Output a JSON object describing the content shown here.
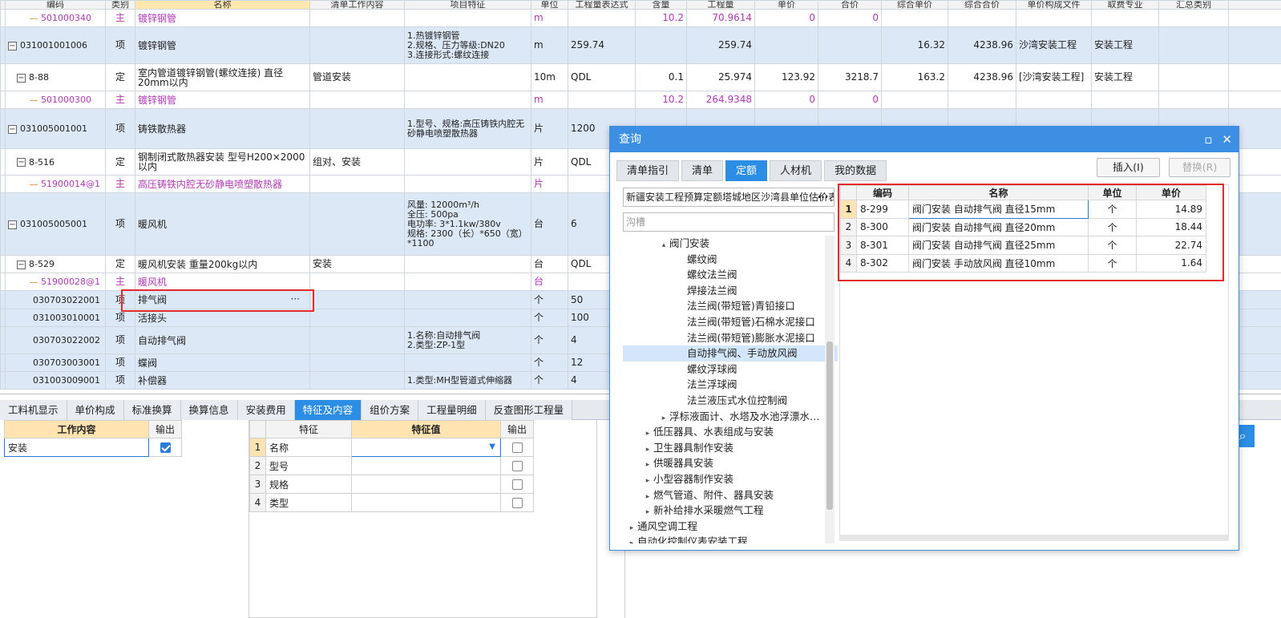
{
  "grid": {
    "headers": [
      "编码",
      "类别",
      "名称",
      "清单工作内容",
      "项目特征",
      "单位",
      "工程量表达式",
      "含量",
      "工程量",
      "单价",
      "合价",
      "综合单价",
      "综合合价",
      "单价构成文件",
      "取费专业",
      "汇总类别"
    ],
    "rows": [
      {
        "kind": "mat",
        "code": "501000340",
        "type": "主",
        "name": "镀锌钢管",
        "work": "",
        "feat": "",
        "unit": "m",
        "expr": "",
        "content": "10.2",
        "qty": "70.9614",
        "price": "0",
        "total": "0",
        "uprice": "",
        "utotal": "",
        "file": "",
        "fee": ""
      },
      {
        "kind": "item",
        "code": "031001001006",
        "type": "项",
        "name": "镀锌钢管",
        "work": "",
        "feat": "1.热镀锌钢管\n2.规格、压力等级:DN20\n3.连接形式:螺纹连接",
        "unit": "m",
        "expr": "259.74",
        "content": "",
        "qty": "259.74",
        "price": "",
        "total": "",
        "uprice": "16.32",
        "utotal": "4238.96",
        "file": "沙湾安装工程",
        "fee": "安装工程"
      },
      {
        "kind": "quota",
        "code": "8-88",
        "type": "定",
        "name": "室内管道镀锌钢管(螺纹连接) 直径20mm以内",
        "work": "管道安装",
        "feat": "",
        "unit": "10m",
        "expr": "QDL",
        "content": "0.1",
        "qty": "25.974",
        "price": "123.92",
        "total": "3218.7",
        "uprice": "163.2",
        "utotal": "4238.96",
        "file": "[沙湾安装工程]",
        "fee": "安装工程"
      },
      {
        "kind": "mat",
        "code": "501000300",
        "type": "主",
        "name": "镀锌钢管",
        "work": "",
        "feat": "",
        "unit": "m",
        "expr": "",
        "content": "10.2",
        "qty": "264.9348",
        "price": "0",
        "total": "0",
        "uprice": "",
        "utotal": "",
        "file": "",
        "fee": ""
      },
      {
        "kind": "item",
        "code": "031005001001",
        "type": "项",
        "name": "铸铁散热器",
        "work": "",
        "feat": "1.型号、规格:高压铸铁内腔无砂静电喷塑散热器",
        "unit": "片",
        "expr": "1200",
        "content": "",
        "qty": "",
        "price": "",
        "total": "",
        "uprice": "",
        "utotal": "",
        "file": "",
        "fee": ""
      },
      {
        "kind": "quota",
        "code": "8-516",
        "type": "定",
        "name": "钢制闭式散热器安装 型号H200×2000以内",
        "work": "组对、安装",
        "feat": "",
        "unit": "片",
        "expr": "QDL",
        "content": "",
        "qty": "",
        "price": "",
        "total": "",
        "uprice": "",
        "utotal": "",
        "file": "",
        "fee": ""
      },
      {
        "kind": "mat",
        "code": "51900014@1",
        "type": "主",
        "name": "高压铸铁内腔无砂静电喷塑散热器",
        "work": "",
        "feat": "",
        "unit": "片",
        "expr": "",
        "content": "",
        "qty": "",
        "price": "",
        "total": "",
        "uprice": "",
        "utotal": "",
        "file": "",
        "fee": ""
      },
      {
        "kind": "item",
        "code": "031005005001",
        "type": "项",
        "name": "暖风机",
        "work": "",
        "feat": "风量: 12000m³/h\n全压: 500pa\n电功率: 3*1.1kw/380v\n规格: 2300（长）*650（宽）*1100",
        "unit": "台",
        "expr": "6",
        "content": "",
        "qty": "",
        "price": "",
        "total": "",
        "uprice": "",
        "utotal": "",
        "file": "",
        "fee": ""
      },
      {
        "kind": "quota",
        "code": "8-529",
        "type": "定",
        "name": "暖风机安装 重量200kg以内",
        "work": "安装",
        "feat": "",
        "unit": "台",
        "expr": "QDL",
        "content": "",
        "qty": "",
        "price": "",
        "total": "",
        "uprice": "",
        "utotal": "",
        "file": "",
        "fee": ""
      },
      {
        "kind": "mat",
        "code": "51900028@1",
        "type": "主",
        "name": "暖风机",
        "work": "",
        "feat": "",
        "unit": "台",
        "expr": "",
        "content": "",
        "qty": "",
        "price": "",
        "total": "",
        "uprice": "",
        "utotal": "",
        "file": "",
        "fee": ""
      },
      {
        "kind": "item",
        "code": "030703022001",
        "type": "项",
        "name": "排气阀",
        "work": "",
        "feat": "",
        "unit": "个",
        "expr": "50",
        "content": "",
        "qty": "",
        "price": "",
        "total": "",
        "uprice": "",
        "utotal": "",
        "file": "",
        "fee": "",
        "more": "···"
      },
      {
        "kind": "item",
        "code": "031003010001",
        "type": "项",
        "name": "活接头",
        "work": "",
        "feat": "",
        "unit": "个",
        "expr": "100",
        "content": "",
        "qty": "",
        "price": "",
        "total": "",
        "uprice": "",
        "utotal": "",
        "file": "",
        "fee": ""
      },
      {
        "kind": "item",
        "code": "030703022002",
        "type": "项",
        "name": "自动排气阀",
        "work": "",
        "feat": "1.名称:自动排气阀\n2.类型:ZP-1型",
        "unit": "个",
        "expr": "4",
        "content": "",
        "qty": "",
        "price": "",
        "total": "",
        "uprice": "",
        "utotal": "",
        "file": "",
        "fee": ""
      },
      {
        "kind": "item",
        "code": "030703003001",
        "type": "项",
        "name": "蝶阀",
        "work": "",
        "feat": "",
        "unit": "个",
        "expr": "12",
        "content": "",
        "qty": "",
        "price": "",
        "total": "",
        "uprice": "",
        "utotal": "",
        "file": "",
        "fee": ""
      },
      {
        "kind": "item",
        "code": "031003009001",
        "type": "项",
        "name": "补偿器",
        "work": "",
        "feat": "1.类型:MH型管道式伸缩器",
        "unit": "个",
        "expr": "4",
        "content": "",
        "qty": "",
        "price": "",
        "total": "",
        "uprice": "",
        "utotal": "",
        "file": "",
        "fee": ""
      }
    ]
  },
  "bottom_tabs": [
    "工料机显示",
    "单价构成",
    "标准换算",
    "换算信息",
    "安装费用",
    "特征及内容",
    "组价方案",
    "工程量明细",
    "反查图形工程量"
  ],
  "bottom_tabs_active": "特征及内容",
  "work_panel": {
    "h_content": "工作内容",
    "h_output": "输出",
    "rows": [
      {
        "content": "安装",
        "output": true
      }
    ]
  },
  "feature_panel": {
    "h_feature": "特征",
    "h_value": "特征值",
    "h_output": "输出",
    "rows": [
      {
        "n": "1",
        "name": "名称",
        "value": ""
      },
      {
        "n": "2",
        "name": "型号",
        "value": ""
      },
      {
        "n": "3",
        "name": "规格",
        "value": ""
      },
      {
        "n": "4",
        "name": "类型",
        "value": ""
      }
    ]
  },
  "dialog": {
    "title": "查询",
    "tabs": [
      "清单指引",
      "清单",
      "定额",
      "人材机",
      "我的数据"
    ],
    "active_tab": "定额",
    "insert_label": "插入(I)",
    "replace_label": "替换(R)",
    "library": "新疆安装工程预算定额塔城地区沙湾县单位估价表",
    "search_placeholder": "沟槽",
    "tree": [
      {
        "label": "阀门安装",
        "level": 2,
        "arrow": "▴"
      },
      {
        "label": "螺纹阀",
        "level": 3
      },
      {
        "label": "螺纹法兰阀",
        "level": 3
      },
      {
        "label": "焊接法兰阀",
        "level": 3
      },
      {
        "label": "法兰阀(带短管)青铅接口",
        "level": 3
      },
      {
        "label": "法兰阀(带短管)石棉水泥接口",
        "level": 3
      },
      {
        "label": "法兰阀(带短管)膨胀水泥接口",
        "level": 3
      },
      {
        "label": "自动排气阀、手动放风阀",
        "level": 3,
        "selected": true
      },
      {
        "label": "螺纹浮球阀",
        "level": 3
      },
      {
        "label": "法兰浮球阀",
        "level": 3
      },
      {
        "label": "法兰液压式水位控制阀",
        "level": 3
      },
      {
        "label": "浮标液面计、水塔及水池浮漂水…",
        "level": 2,
        "arrow": "▸"
      },
      {
        "label": "低压器具、水表组成与安装",
        "level": 1,
        "arrow": "▸"
      },
      {
        "label": "卫生器具制作安装",
        "level": 1,
        "arrow": "▸"
      },
      {
        "label": "供暖器具安装",
        "level": 1,
        "arrow": "▸"
      },
      {
        "label": "小型容器制作安装",
        "level": 1,
        "arrow": "▸"
      },
      {
        "label": "燃气管道、附件、器具安装",
        "level": 1,
        "arrow": "▸"
      },
      {
        "label": "新补给排水采暖燃气工程",
        "level": 1,
        "arrow": "▸"
      },
      {
        "label": "通风空调工程",
        "level": 0,
        "arrow": "▸"
      },
      {
        "label": "自动化控制仪表安装工程",
        "level": 0,
        "arrow": "▸"
      }
    ],
    "results": {
      "headers": [
        "编码",
        "名称",
        "单位",
        "单价"
      ],
      "rows": [
        {
          "n": "1",
          "code": "8-299",
          "name": "阀门安装 自动排气阀 直径15mm",
          "unit": "个",
          "price": "14.89"
        },
        {
          "n": "2",
          "code": "8-300",
          "name": "阀门安装 自动排气阀 直径20mm",
          "unit": "个",
          "price": "18.44"
        },
        {
          "n": "3",
          "code": "8-301",
          "name": "阀门安装 自动排气阀 直径25mm",
          "unit": "个",
          "price": "22.74"
        },
        {
          "n": "4",
          "code": "8-302",
          "name": "阀门安装 手动放风阀 直径10mm",
          "unit": "个",
          "price": "1.64"
        }
      ]
    }
  }
}
